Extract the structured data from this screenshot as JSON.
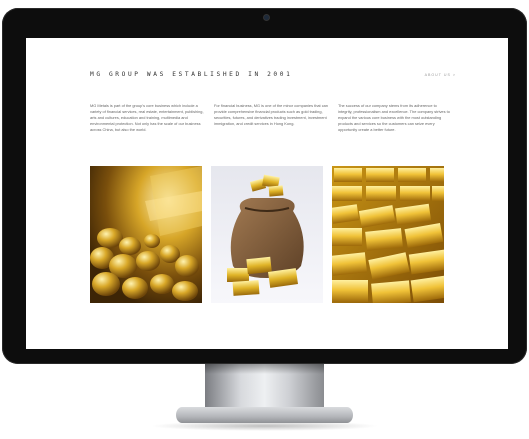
{
  "page": {
    "title": "MG GROUP WAS ESTABLISHED IN 2001",
    "about_link": "ABOUT US >"
  },
  "columns": [
    {
      "text": "MG Metals is part of the group's core business which include a variety of financial services, real estate, entertainment, publishing, arts and cultures, education and training, multimedia and environmental protection. Not only has the scale of our business across China, but also the world."
    },
    {
      "text": "For financial business, MG is one of the minor companies that can provide comprehensive financial products such as gold trading, securities, futures, and derivatives trading investment, investment immigration, and credit services in Hong Kong."
    },
    {
      "text": "The success of our company stems from its adherence to integrity, professionalism and excellence. The company strives to expand the various core business with the most outstanding products and services so the customers can seize every opportunity create a better future."
    }
  ],
  "images": [
    {
      "subject": "gold nuggets"
    },
    {
      "subject": "sack of gold bars"
    },
    {
      "subject": "stacked gold bars"
    }
  ],
  "colors": {
    "bezel": "#0d0d0d",
    "screen": "#ffffff",
    "gold": "#d4a820"
  }
}
